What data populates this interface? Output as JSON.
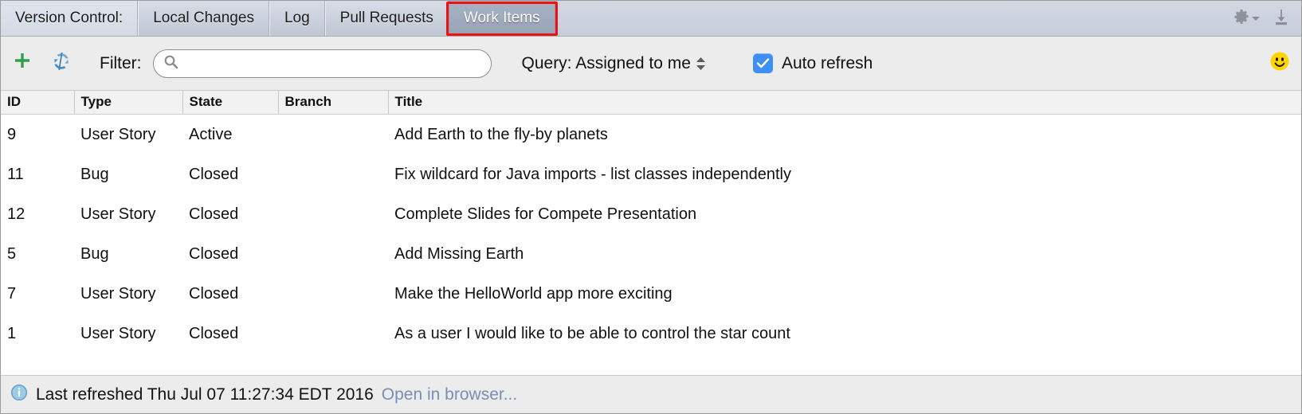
{
  "tabbar": {
    "title": "Version Control:",
    "tabs": [
      {
        "label": "Local Changes",
        "selected": false
      },
      {
        "label": "Log",
        "selected": false
      },
      {
        "label": "Pull Requests",
        "selected": false
      },
      {
        "label": "Work Items",
        "selected": true
      }
    ],
    "settings_icon": "gear-icon",
    "settings_dropdown_icon": "chevron-down-icon",
    "hide_icon": "hide-panel-icon",
    "highlight_color": "#ee1111"
  },
  "toolbar": {
    "add_icon": "plus-icon",
    "add_icon_color": "#2fa14a",
    "refresh_icon": "refresh-icon",
    "refresh_icon_color": "#4a8fc4",
    "filter_label": "Filter:",
    "search_icon": "search-icon",
    "search_value": "",
    "search_placeholder": "",
    "query_label": "Query: Assigned to me",
    "query_stepper_icon": "stepper-updown-icon",
    "auto_refresh_label": "Auto refresh",
    "auto_refresh_checked": true,
    "checkbox_color": "#3d8ef5",
    "smiley_icon": "smiley-face-icon",
    "smiley_color": "#ffd400"
  },
  "table": {
    "columns": [
      "ID",
      "Type",
      "State",
      "Branch",
      "Title"
    ],
    "rows": [
      {
        "id": "9",
        "type": "User Story",
        "state": "Active",
        "branch": "",
        "title": "Add Earth to the fly-by planets"
      },
      {
        "id": "11",
        "type": "Bug",
        "state": "Closed",
        "branch": "",
        "title": "Fix wildcard for Java imports - list classes independently"
      },
      {
        "id": "12",
        "type": "User Story",
        "state": "Closed",
        "branch": "",
        "title": "Complete Slides for Compete Presentation"
      },
      {
        "id": "5",
        "type": "Bug",
        "state": "Closed",
        "branch": "",
        "title": "Add Missing Earth"
      },
      {
        "id": "7",
        "type": "User Story",
        "state": "Closed",
        "branch": "",
        "title": "Make the HelloWorld app more exciting"
      },
      {
        "id": "1",
        "type": "User Story",
        "state": "Closed",
        "branch": "",
        "title": "As a user I would like to be able to control the star count"
      }
    ]
  },
  "statusbar": {
    "info_icon": "info-icon",
    "message": "Last refreshed Thu Jul 07 11:27:34 EDT 2016",
    "link": "Open in browser...",
    "link_color": "#7b8cb5"
  }
}
